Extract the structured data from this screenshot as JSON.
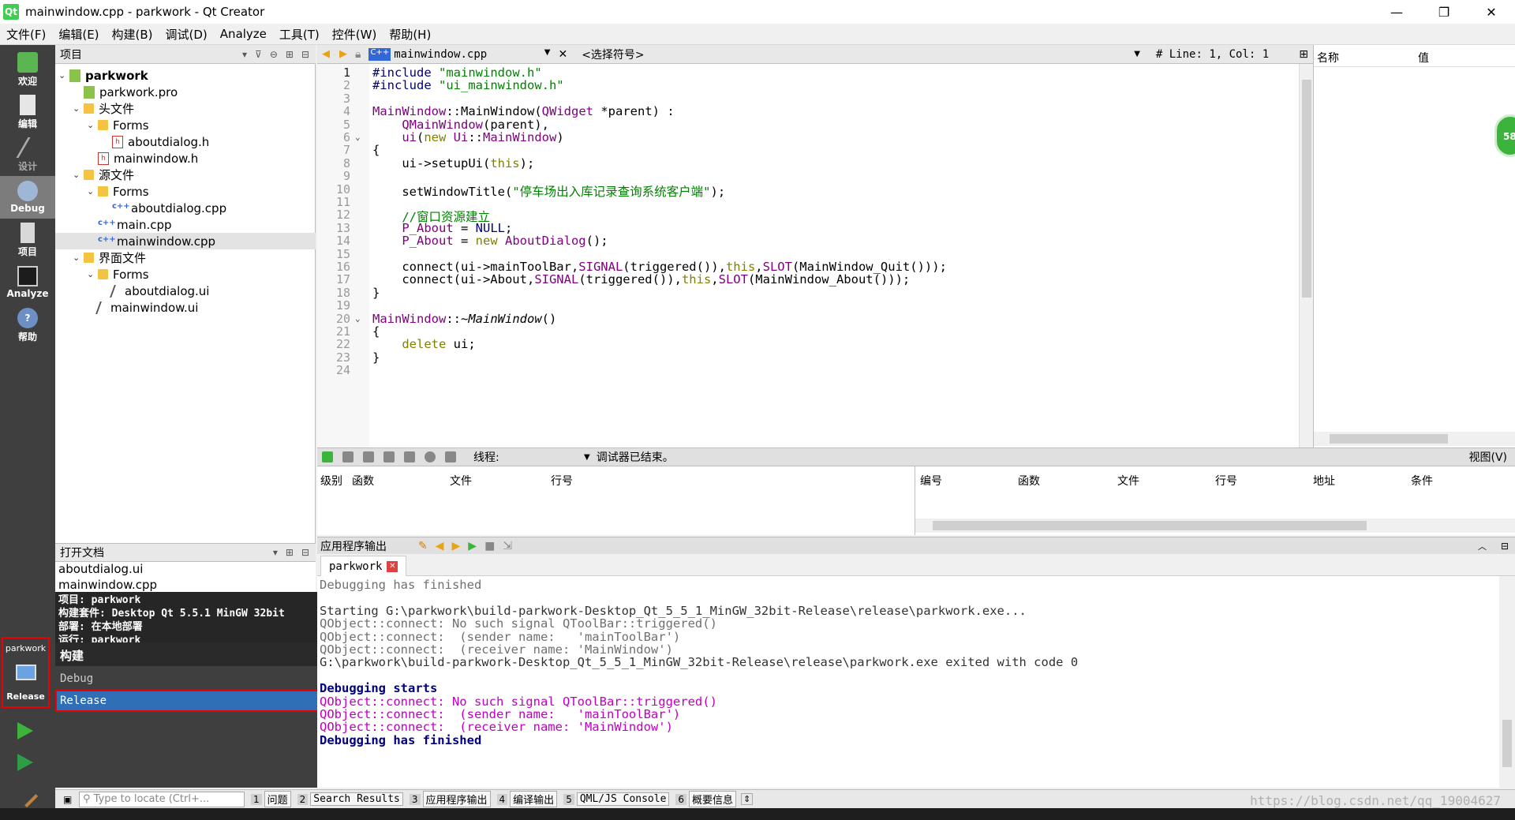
{
  "window": {
    "title": "mainwindow.cpp - parkwork - Qt Creator",
    "minimize": "—",
    "maximize": "❐",
    "close": "✕"
  },
  "menu": [
    "文件(F)",
    "编辑(E)",
    "构建(B)",
    "调试(D)",
    "Analyze",
    "工具(T)",
    "控件(W)",
    "帮助(H)"
  ],
  "modes": [
    {
      "label": "欢迎",
      "icon": "qt-welcome-icon"
    },
    {
      "label": "编辑",
      "icon": "edit-icon"
    },
    {
      "label": "设计",
      "icon": "design-icon"
    },
    {
      "label": "Debug",
      "icon": "debug-icon"
    },
    {
      "label": "项目",
      "icon": "projects-icon"
    },
    {
      "label": "Analyze",
      "icon": "analyze-icon"
    },
    {
      "label": "帮助",
      "icon": "help-icon"
    }
  ],
  "kit_selector": {
    "project": "parkwork",
    "config": "Release"
  },
  "project_panel": {
    "title": "项目",
    "tree": [
      {
        "label": "parkwork",
        "depth": 0,
        "arrow": "⌄",
        "icon": "proj",
        "bold": true
      },
      {
        "label": "parkwork.pro",
        "depth": 1,
        "arrow": "",
        "icon": "proj"
      },
      {
        "label": "头文件",
        "depth": 1,
        "arrow": "⌄",
        "icon": "folder"
      },
      {
        "label": "Forms",
        "depth": 2,
        "arrow": "⌄",
        "icon": "folder"
      },
      {
        "label": "aboutdialog.h",
        "depth": 3,
        "arrow": "",
        "icon": "h"
      },
      {
        "label": "mainwindow.h",
        "depth": 2,
        "arrow": "",
        "icon": "h"
      },
      {
        "label": "源文件",
        "depth": 1,
        "arrow": "⌄",
        "icon": "folder"
      },
      {
        "label": "Forms",
        "depth": 2,
        "arrow": "⌄",
        "icon": "folder"
      },
      {
        "label": "aboutdialog.cpp",
        "depth": 3,
        "arrow": "",
        "icon": "cpp"
      },
      {
        "label": "main.cpp",
        "depth": 2,
        "arrow": "",
        "icon": "cpp"
      },
      {
        "label": "mainwindow.cpp",
        "depth": 2,
        "arrow": "",
        "icon": "cpp",
        "selected": true
      },
      {
        "label": "界面文件",
        "depth": 1,
        "arrow": "⌄",
        "icon": "folder"
      },
      {
        "label": "Forms",
        "depth": 2,
        "arrow": "⌄",
        "icon": "folder"
      },
      {
        "label": "aboutdialog.ui",
        "depth": 3,
        "arrow": "",
        "icon": "ui"
      },
      {
        "label": "mainwindow.ui",
        "depth": 2,
        "arrow": "",
        "icon": "ui"
      }
    ]
  },
  "open_docs": {
    "title": "打开文档",
    "items": [
      "aboutdialog.ui",
      "mainwindow.cpp"
    ]
  },
  "kit_popup": {
    "info_lines": [
      "项目: parkwork",
      "构建套件: Desktop Qt 5.5.1 MinGW 32bit",
      "部署: 在本地部署",
      "运行: parkwork"
    ],
    "build_label": "构建",
    "debug": "Debug",
    "release": "Release"
  },
  "editor_toolbar": {
    "file": "mainwindow.cpp",
    "symbol": "<选择符号>",
    "position": "#  Line: 1, Col: 1"
  },
  "editor": {
    "lines": [
      [
        {
          "t": "#include ",
          "c": "nm"
        },
        {
          "t": "\"mainwindow.h\"",
          "c": "str"
        }
      ],
      [
        {
          "t": "#include ",
          "c": "nm"
        },
        {
          "t": "\"ui_mainwindow.h\"",
          "c": "str"
        }
      ],
      [],
      [
        {
          "t": "MainWindow",
          "c": "ty"
        },
        {
          "t": "::",
          "c": ""
        },
        {
          "t": "MainWindow",
          "c": ""
        },
        {
          "t": "(",
          "c": ""
        },
        {
          "t": "QWidget",
          "c": "ty"
        },
        {
          "t": " *parent) :",
          "c": ""
        }
      ],
      [
        {
          "t": "    QMainWindow",
          "c": "ty"
        },
        {
          "t": "(parent),",
          "c": ""
        }
      ],
      [
        {
          "t": "    ui",
          "c": "ty"
        },
        {
          "t": "(",
          "c": ""
        },
        {
          "t": "new",
          "c": "kw"
        },
        {
          "t": " Ui",
          "c": "ty"
        },
        {
          "t": "::",
          "c": ""
        },
        {
          "t": "MainWindow",
          "c": "ty"
        },
        {
          "t": ")",
          "c": ""
        }
      ],
      [
        {
          "t": "{",
          "c": ""
        }
      ],
      [
        {
          "t": "    ui->setupUi(",
          "c": ""
        },
        {
          "t": "this",
          "c": "kw"
        },
        {
          "t": ");",
          "c": ""
        }
      ],
      [],
      [
        {
          "t": "    setWindowTitle(",
          "c": ""
        },
        {
          "t": "\"停车场出入库记录查询系统客户端\"",
          "c": "str"
        },
        {
          "t": ");",
          "c": ""
        }
      ],
      [],
      [
        {
          "t": "    //窗口资源建立",
          "c": "cm"
        }
      ],
      [
        {
          "t": "    P_About",
          "c": "ty"
        },
        {
          "t": " = ",
          "c": ""
        },
        {
          "t": "NULL",
          "c": "nm"
        },
        {
          "t": ";",
          "c": ""
        }
      ],
      [
        {
          "t": "    P_About",
          "c": "ty"
        },
        {
          "t": " = ",
          "c": ""
        },
        {
          "t": "new",
          "c": "kw"
        },
        {
          "t": " AboutDialog",
          "c": "ty"
        },
        {
          "t": "();",
          "c": ""
        }
      ],
      [],
      [
        {
          "t": "    connect(ui->mainToolBar,",
          "c": ""
        },
        {
          "t": "SIGNAL",
          "c": "ty"
        },
        {
          "t": "(triggered()),",
          "c": ""
        },
        {
          "t": "this",
          "c": "kw"
        },
        {
          "t": ",",
          "c": ""
        },
        {
          "t": "SLOT",
          "c": "ty"
        },
        {
          "t": "(MainWindow_Quit()));",
          "c": ""
        }
      ],
      [
        {
          "t": "    connect(ui->About,",
          "c": ""
        },
        {
          "t": "SIGNAL",
          "c": "ty"
        },
        {
          "t": "(triggered()),",
          "c": ""
        },
        {
          "t": "this",
          "c": "kw"
        },
        {
          "t": ",",
          "c": ""
        },
        {
          "t": "SLOT",
          "c": "ty"
        },
        {
          "t": "(MainWindow_About()));",
          "c": ""
        }
      ],
      [
        {
          "t": "}",
          "c": ""
        }
      ],
      [],
      [
        {
          "t": "MainWindow",
          "c": "ty"
        },
        {
          "t": "::",
          "c": ""
        },
        {
          "t": "~MainWindow",
          "c": "it"
        },
        {
          "t": "()",
          "c": ""
        }
      ],
      [
        {
          "t": "{",
          "c": ""
        }
      ],
      [
        {
          "t": "    delete",
          "c": "kw"
        },
        {
          "t": " ui;",
          "c": ""
        }
      ],
      [
        {
          "t": "}",
          "c": ""
        }
      ],
      []
    ],
    "fold_lines": [
      6,
      20
    ]
  },
  "locals": {
    "col_name": "名称",
    "col_value": "值",
    "badge": "58"
  },
  "debug_toolbar": {
    "thread_label": "线程:",
    "status": "调试器已结束。",
    "view": "视图(V)"
  },
  "stack_columns": [
    "级别",
    "函数",
    "文件",
    "行号"
  ],
  "breakpoint_columns": [
    "编号",
    "函数",
    "文件",
    "行号",
    "地址",
    "条件"
  ],
  "output": {
    "title": "应用程序输出",
    "tab": "parkwork",
    "lines": [
      {
        "t": "Debugging has finished",
        "c": "og"
      },
      {
        "t": "",
        "c": ""
      },
      {
        "t": "Starting G:\\parkwork\\build-parkwork-Desktop_Qt_5_5_1_MinGW_32bit-Release\\release\\parkwork.exe...",
        "c": "oplain"
      },
      {
        "t": "QObject::connect: No such signal QToolBar::triggered()",
        "c": "og"
      },
      {
        "t": "QObject::connect:  (sender name:   'mainToolBar')",
        "c": "og"
      },
      {
        "t": "QObject::connect:  (receiver name: 'MainWindow')",
        "c": "og"
      },
      {
        "t": "G:\\parkwork\\build-parkwork-Desktop_Qt_5_5_1_MinGW_32bit-Release\\release\\parkwork.exe exited with code 0",
        "c": "oplain"
      },
      {
        "t": "",
        "c": ""
      },
      {
        "t": "Debugging starts",
        "c": "ob"
      },
      {
        "t": "QObject::connect: No such signal QToolBar::triggered()",
        "c": "om"
      },
      {
        "t": "QObject::connect:  (sender name:   'mainToolBar')",
        "c": "om"
      },
      {
        "t": "QObject::connect:  (receiver name: 'MainWindow')",
        "c": "om"
      },
      {
        "t": "Debugging has finished",
        "c": "ob"
      }
    ]
  },
  "statusbar": {
    "locate_placeholder": "Type to locate (Ctrl+...",
    "buttons": [
      {
        "num": "1",
        "label": "问题"
      },
      {
        "num": "2",
        "label": "Search Results"
      },
      {
        "num": "3",
        "label": "应用程序输出"
      },
      {
        "num": "4",
        "label": "编译输出"
      },
      {
        "num": "5",
        "label": "QML/JS Console"
      },
      {
        "num": "6",
        "label": "概要信息"
      }
    ],
    "watermark": "https://blog.csdn.net/qq_19004627"
  }
}
